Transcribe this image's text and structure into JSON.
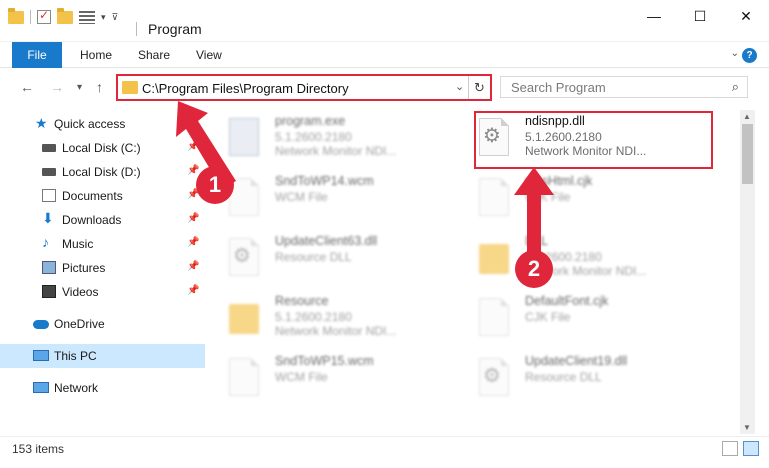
{
  "window": {
    "title": "Program",
    "controls": {
      "minimize": "—",
      "maximize": "☐",
      "close": "✕"
    }
  },
  "ribbon": {
    "tabs": [
      "File",
      "Home",
      "Share",
      "View"
    ],
    "help": "?"
  },
  "navigation": {
    "back": "←",
    "forward": "→",
    "recent": "▾",
    "up": "↑",
    "address": "C:\\Program Files\\Program Directory",
    "refresh": "↻",
    "dropdown": "⌄"
  },
  "search": {
    "placeholder": "Search Program",
    "icon": "⌕"
  },
  "sidebar": {
    "items": [
      {
        "label": "Quick access",
        "icon": "star-icon",
        "pinned": false
      },
      {
        "label": "Local Disk (C:)",
        "icon": "drive-icon",
        "pinned": true
      },
      {
        "label": "Local Disk (D:)",
        "icon": "drive-icon",
        "pinned": true
      },
      {
        "label": "Documents",
        "icon": "documents-icon",
        "pinned": true
      },
      {
        "label": "Downloads",
        "icon": "downloads-icon",
        "pinned": true
      },
      {
        "label": "Music",
        "icon": "music-icon",
        "pinned": true
      },
      {
        "label": "Pictures",
        "icon": "pictures-icon",
        "pinned": true
      },
      {
        "label": "Videos",
        "icon": "videos-icon",
        "pinned": true
      },
      {
        "label": "OneDrive",
        "icon": "onedrive-icon",
        "pinned": false
      },
      {
        "label": "This PC",
        "icon": "this-pc-icon",
        "pinned": false,
        "selected": true
      },
      {
        "label": "Network",
        "icon": "network-icon",
        "pinned": false
      }
    ]
  },
  "files": [
    {
      "name": "program.exe",
      "line1": "5.1.2600.2180",
      "line2": "Network Monitor NDI...",
      "icon": "exe-icon"
    },
    {
      "name": "ndisnpp.dll",
      "line1": "5.1.2600.2180",
      "line2": "Network Monitor NDI...",
      "icon": "dll-icon",
      "highlighted": true
    },
    {
      "name": "SndToWP14.wcm",
      "line1": "WCM File",
      "line2": "",
      "icon": "file-icon"
    },
    {
      "name": "ndisHtml.cjk",
      "line1": "CJK File",
      "line2": "",
      "icon": "file-icon"
    },
    {
      "name": "UpdateClient63.dll",
      "line1": "Resource DLL",
      "line2": "",
      "icon": "dll-icon"
    },
    {
      "name": "DLL",
      "line1": "5.1.2600.2180",
      "line2": "Network Monitor NDI...",
      "icon": "folder-icon"
    },
    {
      "name": "Resource",
      "line1": "5.1.2600.2180",
      "line2": "Network Monitor NDI...",
      "icon": "folder-icon"
    },
    {
      "name": "DefaultFont.cjk",
      "line1": "CJK File",
      "line2": "",
      "icon": "file-icon"
    },
    {
      "name": "SndToWP15.wcm",
      "line1": "WCM File",
      "line2": "",
      "icon": "file-icon"
    },
    {
      "name": "UpdateClient19.dll",
      "line1": "Resource DLL",
      "line2": "",
      "icon": "dll-icon"
    }
  ],
  "annotations": {
    "step1": "1",
    "step2": "2",
    "color": "#e0263b"
  },
  "status": {
    "count": "153 items"
  },
  "colors": {
    "accent": "#1979ca",
    "highlight": "#e0263b",
    "selection": "#cce8ff"
  }
}
